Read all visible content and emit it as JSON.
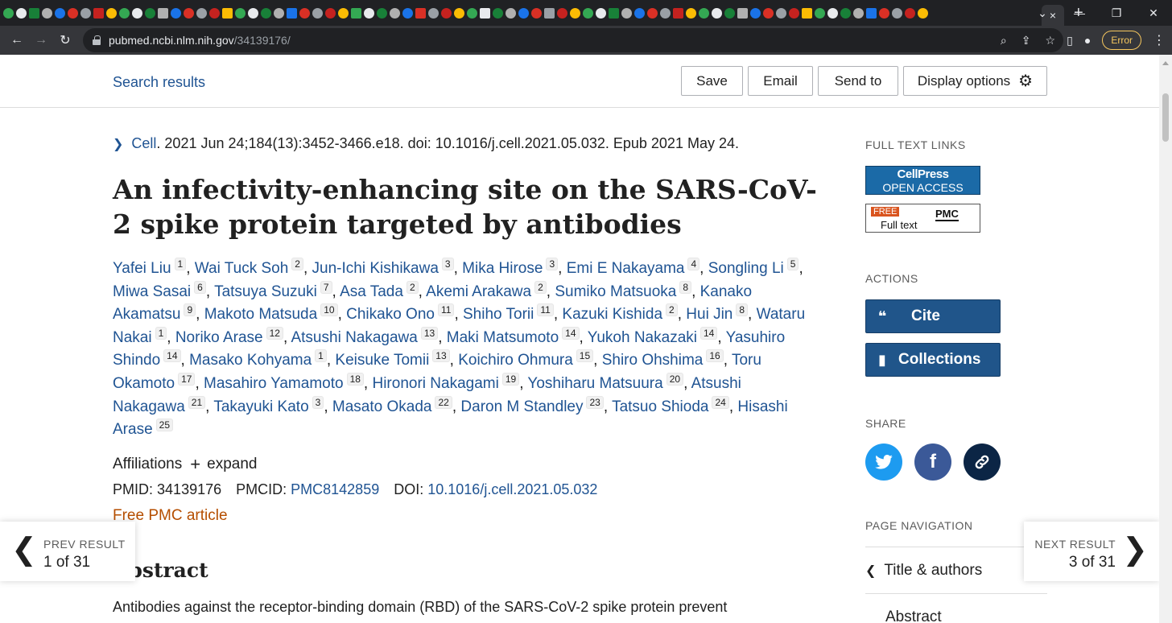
{
  "browser": {
    "url_host": "pubmed.ncbi.nlm.nih.gov",
    "url_path": "/34139176/",
    "error_label": "Error",
    "tab_close": "×",
    "new_tab": "+"
  },
  "header": {
    "search_results": "Search results",
    "save": "Save",
    "email": "Email",
    "send_to": "Send to",
    "display_options": "Display options"
  },
  "article": {
    "journal": "Cell",
    "citation_rest": ". 2021 Jun 24;184(13):3452-3466.e18. doi: 10.1016/j.cell.2021.05.032. Epub 2021 May 24.",
    "title": "An infectivity-enhancing site on the SARS-CoV-2 spike protein targeted by antibodies",
    "authors": [
      {
        "name": "Yafei Liu",
        "aff": "1"
      },
      {
        "name": "Wai Tuck Soh",
        "aff": "2"
      },
      {
        "name": "Jun-Ichi Kishikawa",
        "aff": "3"
      },
      {
        "name": "Mika Hirose",
        "aff": "3"
      },
      {
        "name": "Emi E Nakayama",
        "aff": "4"
      },
      {
        "name": "Songling Li",
        "aff": "5"
      },
      {
        "name": "Miwa Sasai",
        "aff": "6"
      },
      {
        "name": "Tatsuya Suzuki",
        "aff": "7"
      },
      {
        "name": "Asa Tada",
        "aff": "2"
      },
      {
        "name": "Akemi Arakawa",
        "aff": "2"
      },
      {
        "name": "Sumiko Matsuoka",
        "aff": "8"
      },
      {
        "name": "Kanako Akamatsu",
        "aff": "9"
      },
      {
        "name": "Makoto Matsuda",
        "aff": "10"
      },
      {
        "name": "Chikako Ono",
        "aff": "11"
      },
      {
        "name": "Shiho Torii",
        "aff": "11"
      },
      {
        "name": "Kazuki Kishida",
        "aff": "2"
      },
      {
        "name": "Hui Jin",
        "aff": "8"
      },
      {
        "name": "Wataru Nakai",
        "aff": "1"
      },
      {
        "name": "Noriko Arase",
        "aff": "12"
      },
      {
        "name": "Atsushi Nakagawa",
        "aff": "13"
      },
      {
        "name": "Maki Matsumoto",
        "aff": "14"
      },
      {
        "name": "Yukoh Nakazaki",
        "aff": "14"
      },
      {
        "name": "Yasuhiro Shindo",
        "aff": "14"
      },
      {
        "name": "Masako Kohyama",
        "aff": "1"
      },
      {
        "name": "Keisuke Tomii",
        "aff": "13"
      },
      {
        "name": "Koichiro Ohmura",
        "aff": "15"
      },
      {
        "name": "Shiro Ohshima",
        "aff": "16"
      },
      {
        "name": "Toru Okamoto",
        "aff": "17"
      },
      {
        "name": "Masahiro Yamamoto",
        "aff": "18"
      },
      {
        "name": "Hironori Nakagami",
        "aff": "19"
      },
      {
        "name": "Yoshiharu Matsuura",
        "aff": "20"
      },
      {
        "name": "Atsushi Nakagawa",
        "aff": "21"
      },
      {
        "name": "Takayuki Kato",
        "aff": "3"
      },
      {
        "name": "Masato Okada",
        "aff": "22"
      },
      {
        "name": "Daron M Standley",
        "aff": "23"
      },
      {
        "name": "Tatsuo Shioda",
        "aff": "24"
      },
      {
        "name": "Hisashi Arase",
        "aff": "25"
      }
    ],
    "affiliations_label": "Affiliations",
    "expand_label": "expand",
    "pmid_label": "PMID:",
    "pmid": "34139176",
    "pmcid_label": "PMCID:",
    "pmcid": "PMC8142859",
    "doi_label": "DOI:",
    "doi": "10.1016/j.cell.2021.05.032",
    "free_pmc": "Free PMC article",
    "abstract_heading": "Abstract",
    "abstract_text": "Antibodies against the receptor-binding domain (RBD) of the SARS-CoV-2 spike protein prevent"
  },
  "sidebar": {
    "full_text_links": "FULL TEXT LINKS",
    "cellpress_l1": "CellPress",
    "cellpress_l2": "OPEN ACCESS",
    "pmc_free": "FREE",
    "pmc_fulltext": "Full text",
    "pmc_logo": "PMC",
    "actions": "ACTIONS",
    "cite": "Cite",
    "collections": "Collections",
    "share": "SHARE",
    "page_navigation": "PAGE NAVIGATION",
    "nav_title_authors": "Title & authors",
    "nav_abstract": "Abstract"
  },
  "pager": {
    "prev_label": "PREV RESULT",
    "prev_count": "1 of 31",
    "next_label": "NEXT RESULT",
    "next_count": "3 of 31"
  },
  "colors": {
    "link": "#205493",
    "free_pmc": "#b54e00",
    "action_button": "#20558a",
    "twitter": "#1d9bf0",
    "facebook": "#3b5998",
    "link_share": "#0b2545"
  }
}
